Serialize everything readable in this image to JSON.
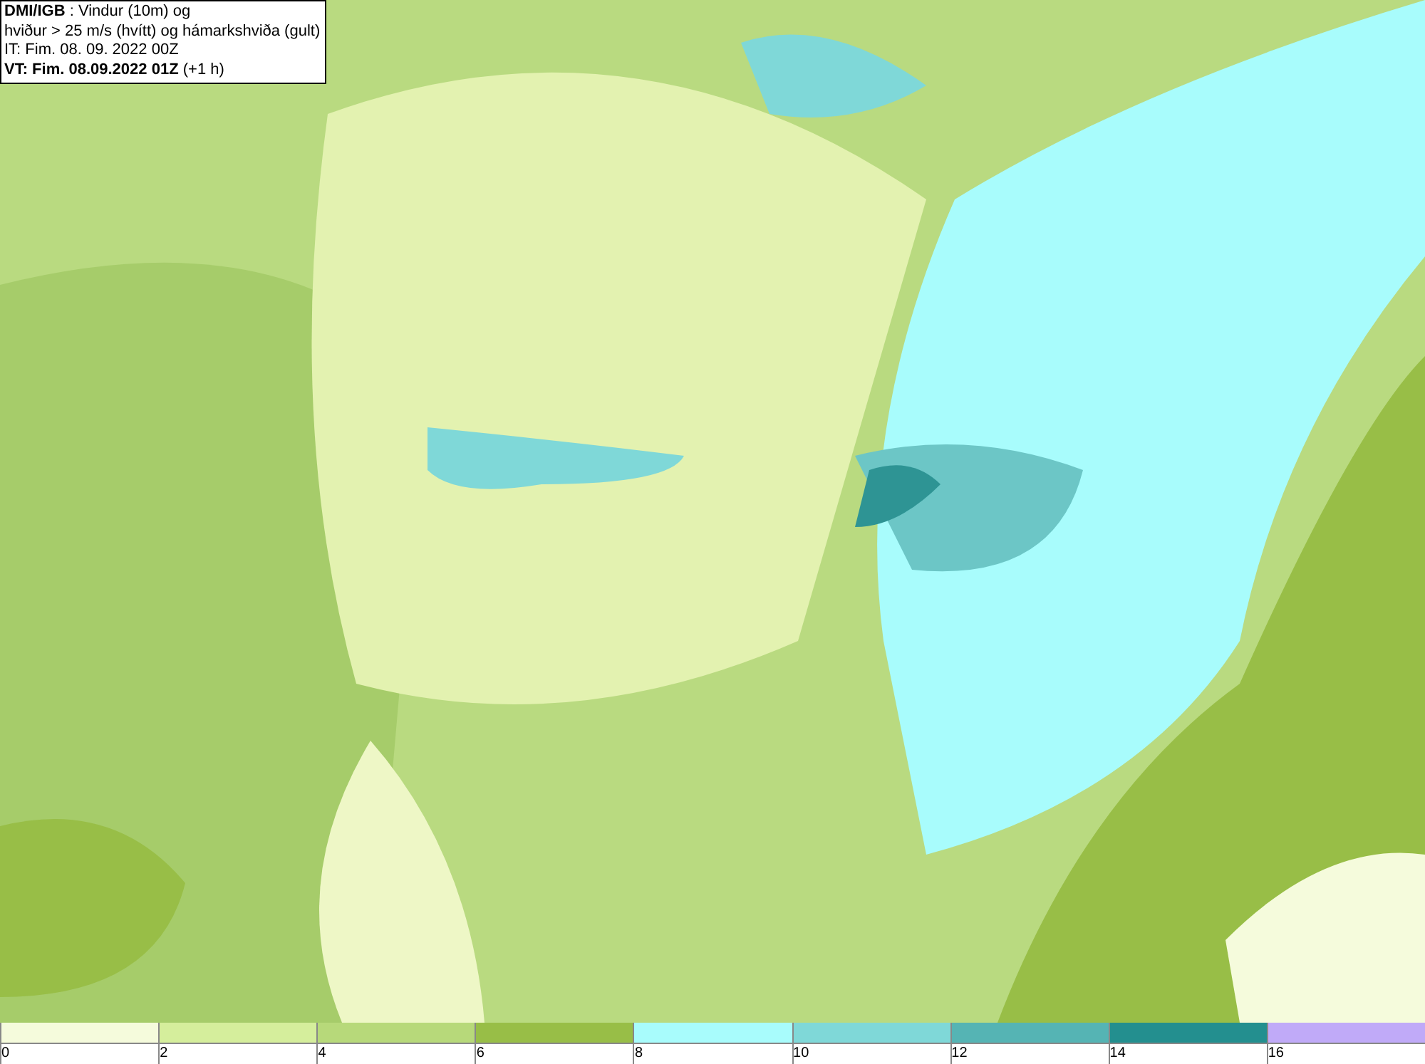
{
  "info": {
    "lines": [
      "**DMI/IGB** : Vindur (10m) og",
      "hviður > 25 m/s (hvítt) og hámarkshviða (gult)",
      "IT: Fim. 08. 09. 2022 00Z",
      "**VT: Fim. 08.09.2022 01Z** (+1 h)"
    ]
  },
  "legend": {
    "bins": [
      {
        "label": "0",
        "color": "#f5fbdc"
      },
      {
        "label": "2",
        "color": "#d5ee9c"
      },
      {
        "label": "4",
        "color": "#b7d97a"
      },
      {
        "label": "6",
        "color": "#98be47"
      },
      {
        "label": "8",
        "color": "#a8fcfc"
      },
      {
        "label": "10",
        "color": "#7fd8d8"
      },
      {
        "label": "12",
        "color": "#55b4b4"
      },
      {
        "label": "14",
        "color": "#238f8f"
      },
      {
        "label": "16",
        "color": "#c0aaf8"
      }
    ]
  }
}
